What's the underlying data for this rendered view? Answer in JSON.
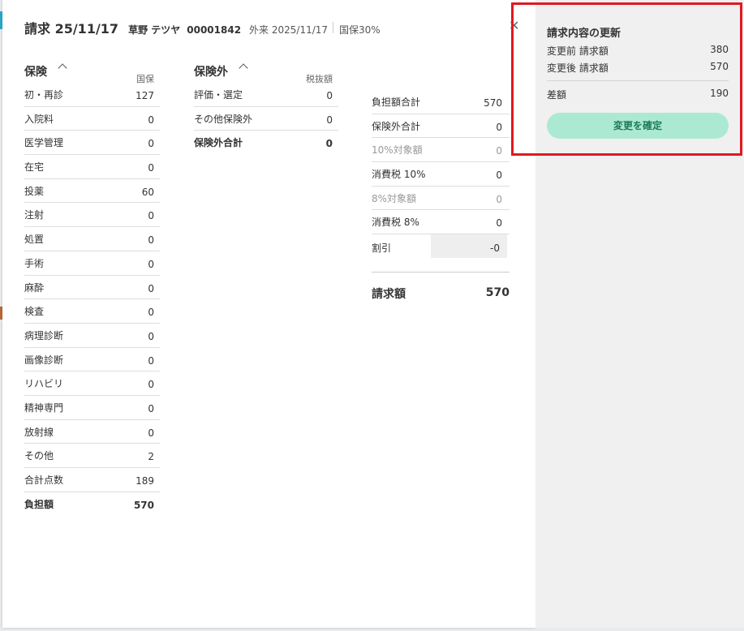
{
  "header": {
    "title": "請求 25/11/17",
    "patient_name": "草野 テツヤ",
    "patient_id": "00001842",
    "visit": "外来 2025/11/17",
    "insurance": "国保30%",
    "close_icon": "close-icon"
  },
  "insurance": {
    "title": "保険",
    "sub": "国保",
    "rows": [
      {
        "label": "初・再診",
        "value": "127"
      },
      {
        "label": "入院料",
        "value": "0"
      },
      {
        "label": "医学管理",
        "value": "0"
      },
      {
        "label": "在宅",
        "value": "0"
      },
      {
        "label": "投薬",
        "value": "60"
      },
      {
        "label": "注射",
        "value": "0"
      },
      {
        "label": "処置",
        "value": "0"
      },
      {
        "label": "手術",
        "value": "0"
      },
      {
        "label": "麻酔",
        "value": "0"
      },
      {
        "label": "検査",
        "value": "0"
      },
      {
        "label": "病理診断",
        "value": "0"
      },
      {
        "label": "画像診断",
        "value": "0"
      },
      {
        "label": "リハビリ",
        "value": "0"
      },
      {
        "label": "精神専門",
        "value": "0"
      },
      {
        "label": "放射線",
        "value": "0"
      },
      {
        "label": "その他",
        "value": "2"
      },
      {
        "label": "合計点数",
        "value": "189"
      }
    ],
    "burden_label": "負担額",
    "burden_value": "570"
  },
  "non_insurance": {
    "title": "保険外",
    "sub": "税抜額",
    "rows": [
      {
        "label": "評価・選定",
        "value": "0"
      },
      {
        "label": "その他保険外",
        "value": "0"
      }
    ],
    "total_label": "保険外合計",
    "total_value": "0"
  },
  "summary": {
    "rows": [
      {
        "label": "負担額合計",
        "value": "570"
      },
      {
        "label": "保険外合計",
        "value": "0"
      },
      {
        "label": "10%対象額",
        "value": "0"
      },
      {
        "label": "消費税 10%",
        "value": "0"
      },
      {
        "label": "8%対象額",
        "value": "0"
      },
      {
        "label": "消費税 8%",
        "value": "0"
      }
    ],
    "discount_label": "割引",
    "discount_value": "-0",
    "billing_label": "請求額",
    "billing_value": "570"
  },
  "update_panel": {
    "title": "請求内容の更新",
    "before_label": "変更前 請求額",
    "before_value": "380",
    "after_label": "変更後 請求額",
    "after_value": "570",
    "diff_label": "差額",
    "diff_value": "190",
    "confirm_label": "変更を確定",
    "highlight_color": "#e0191f",
    "button_color": "#ace9d3"
  }
}
